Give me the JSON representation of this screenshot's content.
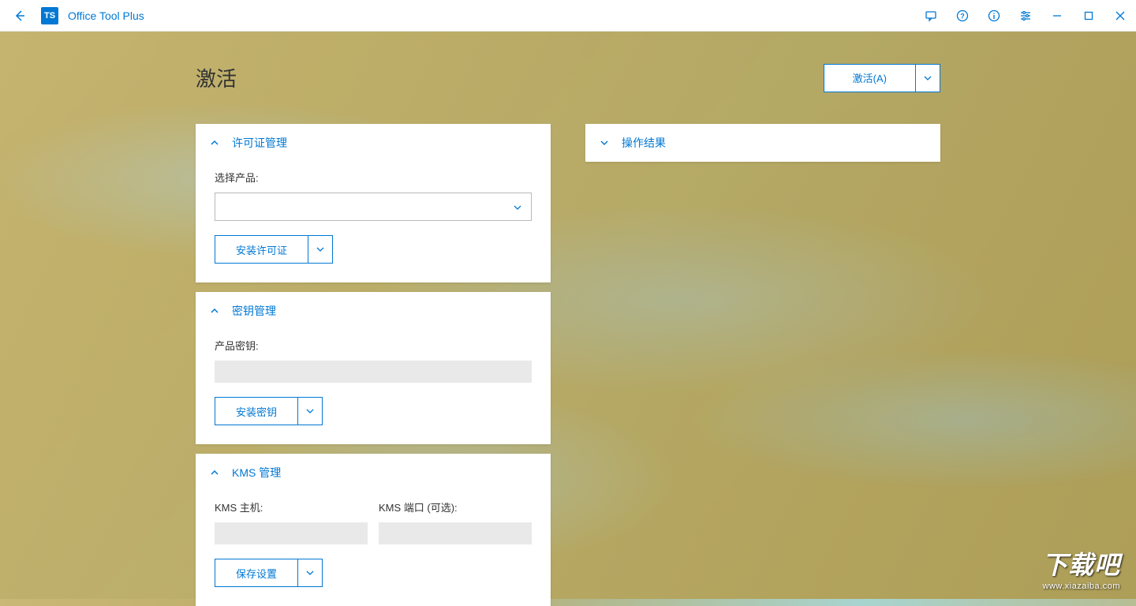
{
  "app": {
    "title": "Office Tool Plus",
    "logo_text": "TS"
  },
  "page": {
    "title": "激活",
    "activate_button": "激活(A)"
  },
  "panels": {
    "license": {
      "title": "许可证管理",
      "product_label": "选择产品:",
      "install_button": "安装许可证"
    },
    "key": {
      "title": "密钥管理",
      "key_label": "产品密钥:",
      "key_value": "",
      "install_button": "安装密钥"
    },
    "kms": {
      "title": "KMS 管理",
      "host_label": "KMS 主机:",
      "host_value": "",
      "port_label": "KMS 端口 (可选):",
      "port_value": "",
      "save_button": "保存设置"
    },
    "result": {
      "title": "操作结果"
    }
  },
  "watermark": {
    "text": "下载吧",
    "url": "www.xiazaiba.com"
  }
}
